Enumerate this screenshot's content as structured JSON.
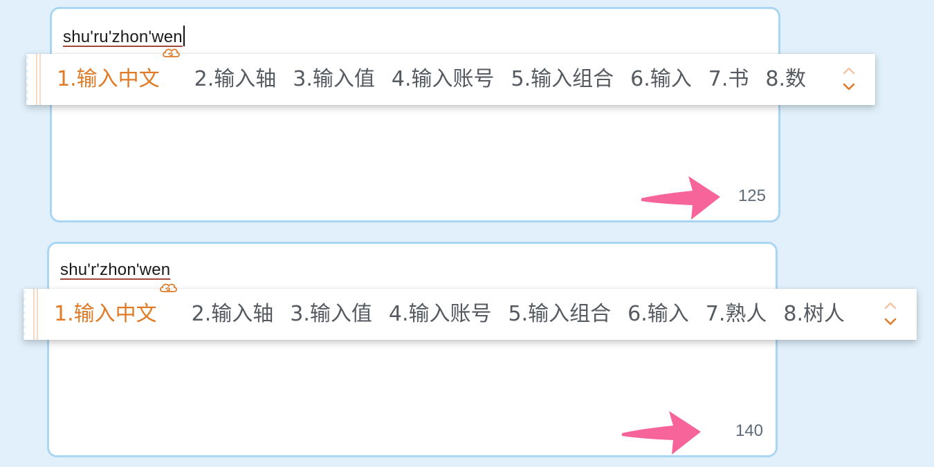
{
  "boxes": [
    {
      "composition": "shu'ru'zhon'wen",
      "count": "125",
      "candidates": [
        "1.输入中文",
        "2.输入轴",
        "3.输入值",
        "4.输入账号",
        "5.输入组合",
        "6.输入",
        "7.书",
        "8.数"
      ]
    },
    {
      "composition": "shu'r'zhon'wen",
      "count": "140",
      "candidates": [
        "1.输入中文",
        "2.输入轴",
        "3.输入值",
        "4.输入账号",
        "5.输入组合",
        "6.输入",
        "7.熟人",
        "8.树人"
      ]
    }
  ],
  "icons": {
    "cloud": "cloud-icon",
    "page_up": "chevron-up-icon",
    "page_down": "chevron-down-icon",
    "arrow": "pink-arrow-icon"
  },
  "colors": {
    "background": "#e1f0fb",
    "box_border": "#a9d6f3",
    "selected_candidate": "#e07a26",
    "candidate_text": "#555a60",
    "arrow": "#f7649a",
    "count_text": "#5d6b78"
  }
}
